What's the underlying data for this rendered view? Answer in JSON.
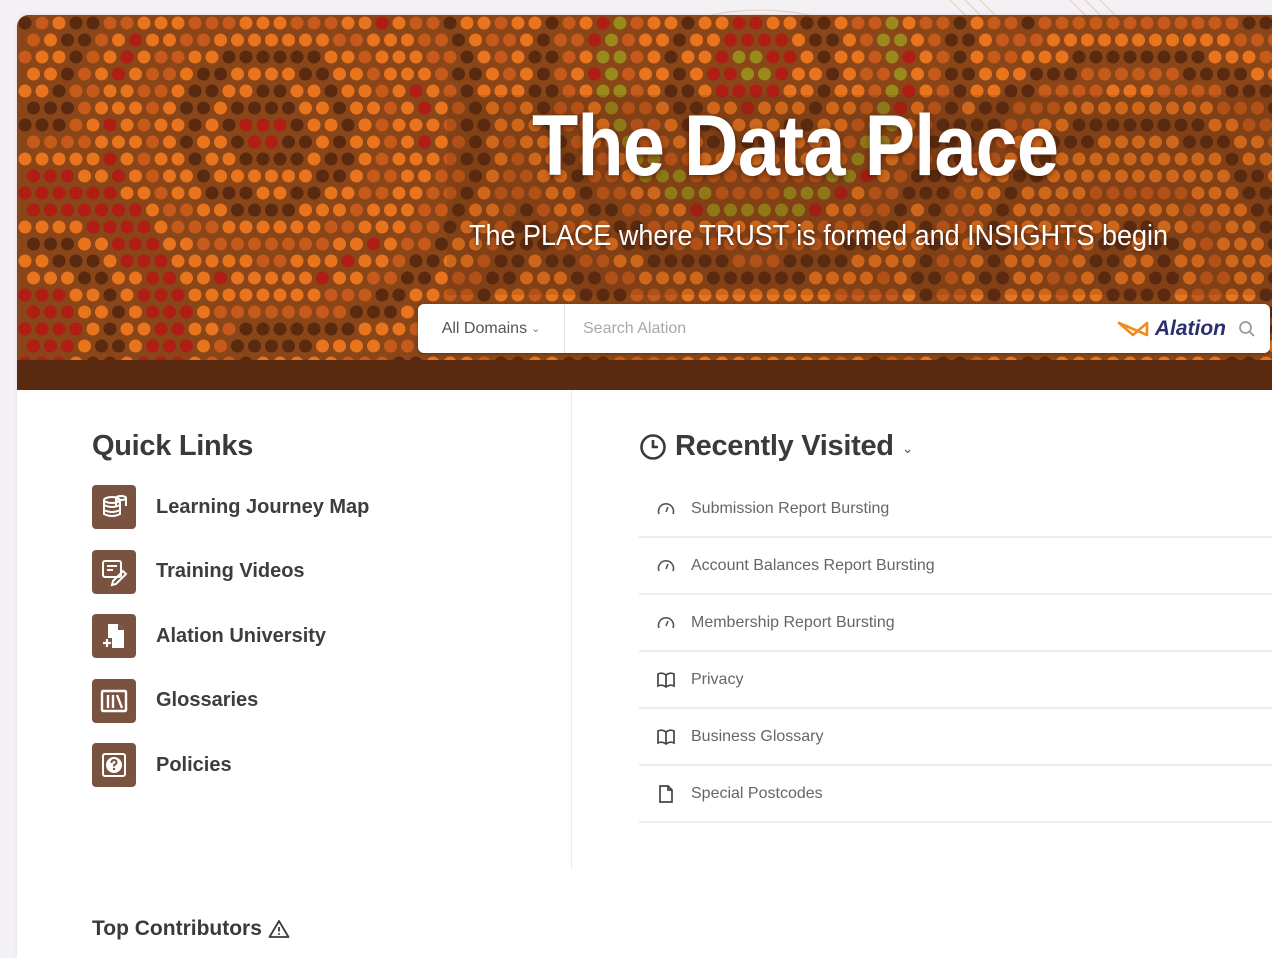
{
  "banner": {
    "title": "The Data Place",
    "subtitle": "The PLACE where TRUST is formed and INSIGHTS begin"
  },
  "search": {
    "domain_label": "All Domains",
    "placeholder": "Search Alation",
    "brand": "Alation"
  },
  "quick_links": {
    "title": "Quick Links",
    "items": [
      {
        "label": "Learning Journey Map",
        "icon": "database-stack-icon"
      },
      {
        "label": "Training Videos",
        "icon": "edit-document-icon"
      },
      {
        "label": "Alation University",
        "icon": "add-file-icon"
      },
      {
        "label": "Glossaries",
        "icon": "books-icon"
      },
      {
        "label": "Policies",
        "icon": "question-circle-icon"
      }
    ]
  },
  "recently_visited": {
    "title": "Recently Visited",
    "items": [
      {
        "label": "Submission Report Bursting",
        "icon": "gauge-icon"
      },
      {
        "label": "Account Balances Report Bursting",
        "icon": "gauge-icon"
      },
      {
        "label": "Membership Report Bursting",
        "icon": "gauge-icon"
      },
      {
        "label": "Privacy",
        "icon": "open-book-icon"
      },
      {
        "label": "Business Glossary",
        "icon": "open-book-icon"
      },
      {
        "label": "Special Postcodes",
        "icon": "document-icon"
      }
    ]
  },
  "top_contributors": {
    "title": "Top Contributors"
  },
  "colors": {
    "banner_brown": "#8a4518",
    "banner_orange": "#e8741e",
    "icon_tile": "#7a5340",
    "brand_navy": "#2a2f6e",
    "brand_orange": "#f08a1c"
  }
}
